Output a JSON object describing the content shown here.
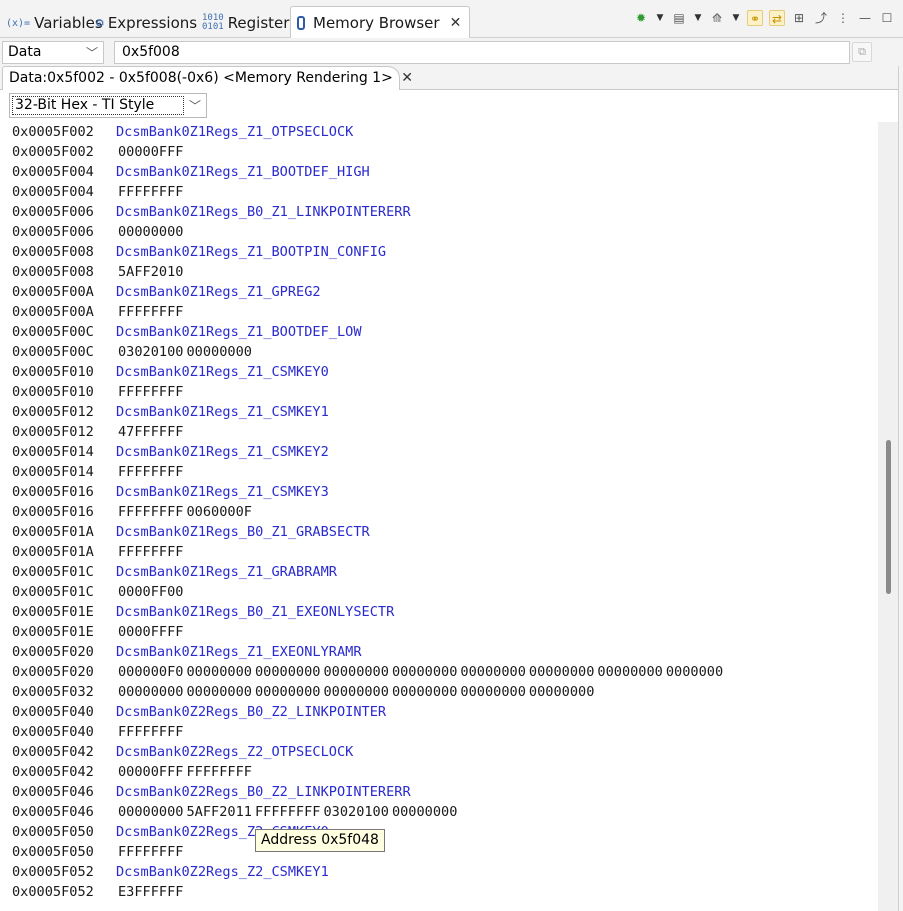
{
  "tabs": [
    {
      "label": "Variables",
      "icon": "(x)="
    },
    {
      "label": "Expressions",
      "icon": "⁶⁸"
    },
    {
      "label": "Registers",
      "icon": "1010\n0101"
    },
    {
      "label": "Memory Browser"
    }
  ],
  "address_bar": {
    "memory_space": "Data",
    "address": "0x5f008"
  },
  "rendering_tab": "Data:0x5f002 - 0x5f008(-0x6) <Memory Rendering 1>",
  "format": "32-Bit Hex - TI Style",
  "tooltip": "Address 0x5f048",
  "colors": {
    "symbol": "#2a2ad0",
    "tooltip_bg": "#ffffe1"
  },
  "rows": [
    {
      "addr": "0x0005F002",
      "sym": "DcsmBank0Z1Regs_Z1_OTPSECLOCK"
    },
    {
      "addr": "0x0005F002",
      "vals": [
        "00000FFF"
      ]
    },
    {
      "addr": "0x0005F004",
      "sym": "DcsmBank0Z1Regs_Z1_BOOTDEF_HIGH"
    },
    {
      "addr": "0x0005F004",
      "vals": [
        "FFFFFFFF"
      ]
    },
    {
      "addr": "0x0005F006",
      "sym": "DcsmBank0Z1Regs_B0_Z1_LINKPOINTERERR"
    },
    {
      "addr": "0x0005F006",
      "vals": [
        "00000000"
      ]
    },
    {
      "addr": "0x0005F008",
      "sym": "DcsmBank0Z1Regs_Z1_BOOTPIN_CONFIG"
    },
    {
      "addr": "0x0005F008",
      "vals": [
        "5AFF2010"
      ]
    },
    {
      "addr": "0x0005F00A",
      "sym": "DcsmBank0Z1Regs_Z1_GPREG2"
    },
    {
      "addr": "0x0005F00A",
      "vals": [
        "FFFFFFFF"
      ]
    },
    {
      "addr": "0x0005F00C",
      "sym": "DcsmBank0Z1Regs_Z1_BOOTDEF_LOW"
    },
    {
      "addr": "0x0005F00C",
      "vals": [
        "03020100",
        "00000000"
      ]
    },
    {
      "addr": "0x0005F010",
      "sym": "DcsmBank0Z1Regs_Z1_CSMKEY0"
    },
    {
      "addr": "0x0005F010",
      "vals": [
        "FFFFFFFF"
      ]
    },
    {
      "addr": "0x0005F012",
      "sym": "DcsmBank0Z1Regs_Z1_CSMKEY1"
    },
    {
      "addr": "0x0005F012",
      "vals": [
        "47FFFFFF"
      ]
    },
    {
      "addr": "0x0005F014",
      "sym": "DcsmBank0Z1Regs_Z1_CSMKEY2"
    },
    {
      "addr": "0x0005F014",
      "vals": [
        "FFFFFFFF"
      ]
    },
    {
      "addr": "0x0005F016",
      "sym": "DcsmBank0Z1Regs_Z1_CSMKEY3"
    },
    {
      "addr": "0x0005F016",
      "vals": [
        "FFFFFFFF",
        "0060000F"
      ]
    },
    {
      "addr": "0x0005F01A",
      "sym": "DcsmBank0Z1Regs_B0_Z1_GRABSECTR"
    },
    {
      "addr": "0x0005F01A",
      "vals": [
        "FFFFFFFF"
      ]
    },
    {
      "addr": "0x0005F01C",
      "sym": "DcsmBank0Z1Regs_Z1_GRABRAMR"
    },
    {
      "addr": "0x0005F01C",
      "vals": [
        "0000FF00"
      ]
    },
    {
      "addr": "0x0005F01E",
      "sym": "DcsmBank0Z1Regs_B0_Z1_EXEONLYSECTR"
    },
    {
      "addr": "0x0005F01E",
      "vals": [
        "0000FFFF"
      ]
    },
    {
      "addr": "0x0005F020",
      "sym": "DcsmBank0Z1Regs_Z1_EXEONLYRAMR"
    },
    {
      "addr": "0x0005F020",
      "vals": [
        "000000F0",
        "00000000",
        "00000000",
        "00000000",
        "00000000",
        "00000000",
        "00000000",
        "00000000",
        "0000000"
      ]
    },
    {
      "addr": "0x0005F032",
      "vals": [
        "00000000",
        "00000000",
        "00000000",
        "00000000",
        "00000000",
        "00000000",
        "00000000"
      ]
    },
    {
      "addr": "0x0005F040",
      "sym": "DcsmBank0Z2Regs_B0_Z2_LINKPOINTER"
    },
    {
      "addr": "0x0005F040",
      "vals": [
        "FFFFFFFF"
      ]
    },
    {
      "addr": "0x0005F042",
      "sym": "DcsmBank0Z2Regs_Z2_OTPSECLOCK"
    },
    {
      "addr": "0x0005F042",
      "vals": [
        "00000FFF",
        "FFFFFFFF"
      ]
    },
    {
      "addr": "0x0005F046",
      "sym": "DcsmBank0Z2Regs_B0_Z2_LINKPOINTERERR"
    },
    {
      "addr": "0x0005F046",
      "vals": [
        "00000000",
        "5AFF2011",
        "FFFFFFFF",
        "03020100",
        "00000000"
      ]
    },
    {
      "addr": "0x0005F050",
      "sym": "DcsmBank0Z2Regs_Z2_CSMKEY0"
    },
    {
      "addr": "0x0005F050",
      "vals": [
        "FFFFFFFF"
      ]
    },
    {
      "addr": "0x0005F052",
      "sym": "DcsmBank0Z2Regs_Z2_CSMKEY1"
    },
    {
      "addr": "0x0005F052",
      "vals": [
        "E3FFFFFF"
      ]
    }
  ]
}
